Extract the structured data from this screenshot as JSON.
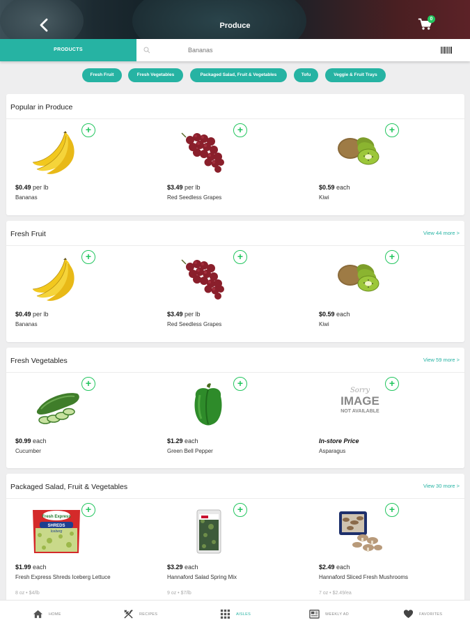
{
  "header": {
    "title": "Produce",
    "cart_count": "0"
  },
  "search": {
    "products_tab": "PRODUCTS",
    "value": "Bananas",
    "placeholder": "Bananas"
  },
  "chips": [
    "Fresh Fruit",
    "Fresh Vegetables",
    "Packaged Salad, Fruit & Vegetables",
    "Tofu",
    "Veggie & Fruit Trays"
  ],
  "sections": [
    {
      "title": "Popular in Produce",
      "view_more": "",
      "products": [
        {
          "price": "$0.49",
          "unit": "per lb",
          "name": "Bananas",
          "image": "banana"
        },
        {
          "price": "$3.49",
          "unit": "per lb",
          "name": "Red Seedless Grapes",
          "image": "grapes"
        },
        {
          "price": "$0.59",
          "unit": "each",
          "name": "Kiwi",
          "image": "kiwi"
        }
      ]
    },
    {
      "title": "Fresh Fruit",
      "view_more": "View 44 more >",
      "products": [
        {
          "price": "$0.49",
          "unit": "per lb",
          "name": "Bananas",
          "image": "banana"
        },
        {
          "price": "$3.49",
          "unit": "per lb",
          "name": "Red Seedless Grapes",
          "image": "grapes"
        },
        {
          "price": "$0.59",
          "unit": "each",
          "name": "Kiwi",
          "image": "kiwi"
        }
      ]
    },
    {
      "title": "Fresh Vegetables",
      "view_more": "View 59 more >",
      "products": [
        {
          "price": "$0.99",
          "unit": "each",
          "name": "Cucumber",
          "image": "cucumber"
        },
        {
          "price": "$1.29",
          "unit": "each",
          "name": "Green Bell Pepper",
          "image": "pepper"
        },
        {
          "price": "In-store Price",
          "unit": "",
          "name": "Asparagus",
          "image": "unavailable",
          "unavailable_text": [
            "Sorry",
            "IMAGE",
            "NOT AVAILABLE"
          ]
        }
      ]
    },
    {
      "title": "Packaged Salad, Fruit & Vegetables",
      "view_more": "View 30 more >",
      "products": [
        {
          "price": "$1.99",
          "unit": "each",
          "name": "Fresh Express Shreds Iceberg Lettuce",
          "size": "8 oz • $4/lb",
          "image": "lettuce",
          "label_text": [
            "Fresh Express",
            "SHREDS",
            "Iceberg"
          ]
        },
        {
          "price": "$3.29",
          "unit": "each",
          "name": "Hannaford Salad Spring Mix",
          "size": "9 oz • $7/lb",
          "image": "springmix"
        },
        {
          "price": "$2.49",
          "unit": "each",
          "name": "Hannaford Sliced Fresh Mushrooms",
          "size": "7 oz • $2.49/ea",
          "image": "mushrooms"
        }
      ]
    }
  ],
  "bottom_nav": [
    {
      "label": "HOME",
      "icon": "home-icon"
    },
    {
      "label": "RECIPES",
      "icon": "fork-knife-icon"
    },
    {
      "label": "AISLES",
      "icon": "grid-icon",
      "active": true
    },
    {
      "label": "WEEKLY AD",
      "icon": "newspaper-icon"
    },
    {
      "label": "FAVORITES",
      "icon": "heart-icon"
    }
  ],
  "colors": {
    "accent": "#26b3a3",
    "add_button": "#22c55e"
  }
}
